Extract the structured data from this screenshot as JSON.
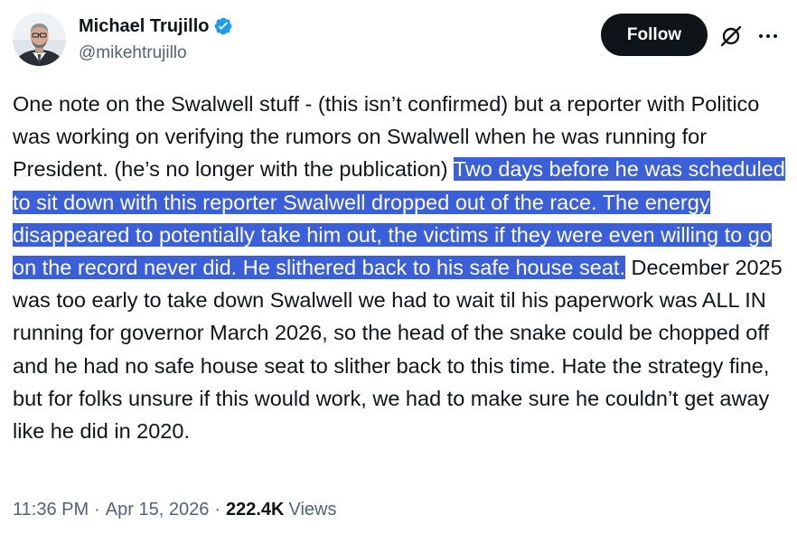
{
  "author": {
    "display_name": "Michael Trujillo",
    "handle": "@mikehtrujillo",
    "verified": true,
    "verified_color": "#1d9bf0"
  },
  "actions": {
    "follow_label": "Follow",
    "grok_icon": "grok-slash-icon",
    "more_icon": "more-horizontal-icon"
  },
  "tweet": {
    "text_before": "One note on the Swalwell stuff - (this isn’t confirmed) but a reporter with Politico was working on verifying the rumors on Swalwell when he was running for President. (he’s no longer with the publication) ",
    "text_highlighted": "Two days before he was scheduled to sit down with this reporter Swalwell dropped out of the race.  The energy disappeared to potentially take him out, the victims if they were even willing to go on the record never did.  He slithered back to his safe house seat.",
    "text_after": " December 2025 was too early to take down Swalwell we had to wait til his paperwork was ALL IN running for governor March 2026, so the head of the snake could be chopped off and he had no safe house seat to slither back to this time.  Hate the strategy fine, but for folks unsure if this would work, we had to make sure he couldn’t get away like he did in 2020.",
    "highlight_color": "#3a5fd8"
  },
  "meta": {
    "time": "11:36 PM",
    "separator": "·",
    "date": "Apr 15, 2026",
    "views_count": "222.4K",
    "views_label": "Views"
  }
}
